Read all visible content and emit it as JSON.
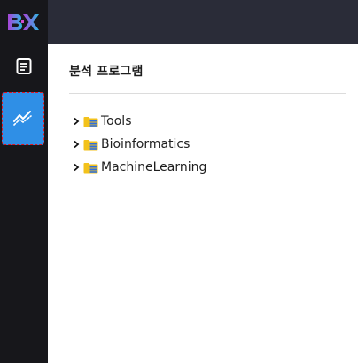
{
  "app": {
    "logo_text": "BX"
  },
  "sidebar": {
    "items": [
      {
        "name": "document",
        "icon": "document-icon",
        "active": false
      },
      {
        "name": "analysis",
        "icon": "chart-trend-icon",
        "active": true
      }
    ]
  },
  "main": {
    "title": "분석 프로그램",
    "tree": [
      {
        "label": "Tools",
        "icon": "folder-icon",
        "expanded": false
      },
      {
        "label": "Bioinformatics",
        "icon": "folder-icon",
        "expanded": false
      },
      {
        "label": "MachineLearning",
        "icon": "folder-icon",
        "expanded": false
      }
    ]
  },
  "colors": {
    "sidebar_bg": "#17171b",
    "topbar_bg": "#2a2c38",
    "active_nav": "#2f8fe6",
    "active_border": "#e0141e",
    "folder_yellow": "#f3c21b",
    "folder_blue": "#2f6fe0"
  }
}
